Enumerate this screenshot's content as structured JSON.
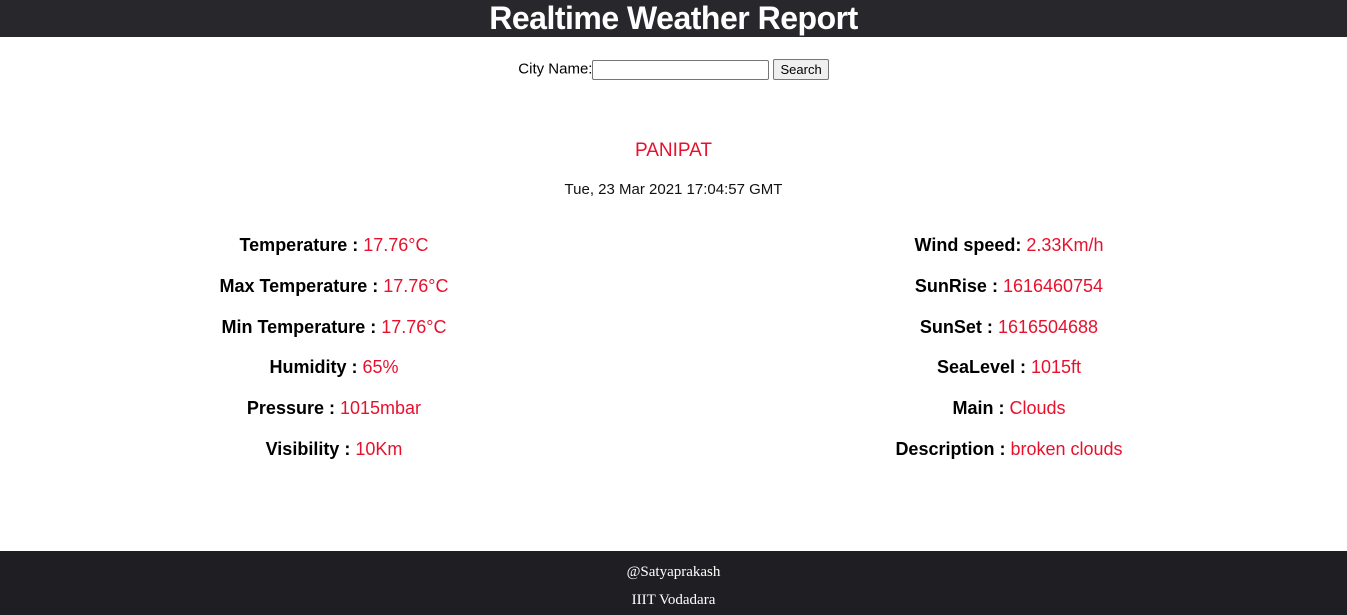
{
  "header": {
    "title": "Realtime Weather Report"
  },
  "search": {
    "label": "City Name:",
    "value": "",
    "placeholder": "",
    "button_label": "Search"
  },
  "weather": {
    "city": "PANIPAT",
    "datetime": "Tue, 23 Mar 2021 17:04:57 GMT",
    "left": [
      {
        "label": "Temperature :",
        "value": "17.76°C"
      },
      {
        "label": "Max Temperature :",
        "value": "17.76°C"
      },
      {
        "label": "Min Temperature :",
        "value": "17.76°C"
      },
      {
        "label": "Humidity :",
        "value": "65%"
      },
      {
        "label": "Pressure :",
        "value": "1015mbar"
      },
      {
        "label": "Visibility :",
        "value": "10Km"
      }
    ],
    "right": [
      {
        "label": "Wind speed:",
        "value": "2.33Km/h"
      },
      {
        "label": "SunRise :",
        "value": "1616460754"
      },
      {
        "label": "SunSet :",
        "value": "1616504688"
      },
      {
        "label": "SeaLevel :",
        "value": "1015ft"
      },
      {
        "label": "Main :",
        "value": "Clouds"
      },
      {
        "label": "Description :",
        "value": "broken clouds"
      }
    ]
  },
  "footer": {
    "author": "@Satyaprakash",
    "org": "IIIT Vodadara"
  },
  "colors": {
    "header_bg": "#28272c",
    "accent": "#e8112d",
    "footer_bg": "#1f1f23"
  }
}
